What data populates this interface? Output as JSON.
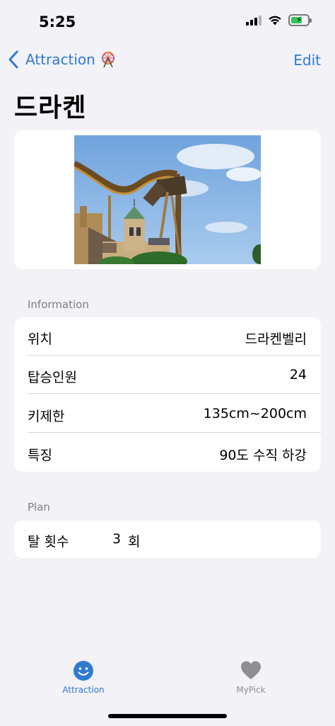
{
  "status_bar": {
    "time": "5:25",
    "icons": [
      "signal-icon",
      "wifi-icon",
      "battery-charging-icon"
    ]
  },
  "nav": {
    "back_label": "Attraction",
    "back_icon": "chevron-left-icon",
    "title_icon": "ferris-wheel-icon",
    "edit_label": "Edit",
    "accent_color": "#2f7ad1"
  },
  "page_title": "드라켄",
  "image": {
    "description_icon": "roller-coaster-photo"
  },
  "information": {
    "header": "Information",
    "rows": [
      {
        "label": "위치",
        "value": "드라켄벨리"
      },
      {
        "label": "탑승인원",
        "value": "24"
      },
      {
        "label": "키제한",
        "value": "135cm~200cm"
      },
      {
        "label": "특징",
        "value": "90도 수직 하강"
      }
    ]
  },
  "plan": {
    "header": "Plan",
    "label": "탈 횟수",
    "count": "3",
    "unit": "회"
  },
  "tabbar": {
    "tabs": [
      {
        "label": "Attraction",
        "icon": "smiley-face-icon",
        "selected": true,
        "color": "#2f7ad1"
      },
      {
        "label": "MyPick",
        "icon": "heart-icon",
        "selected": false,
        "color": "#8e8e93"
      }
    ]
  }
}
